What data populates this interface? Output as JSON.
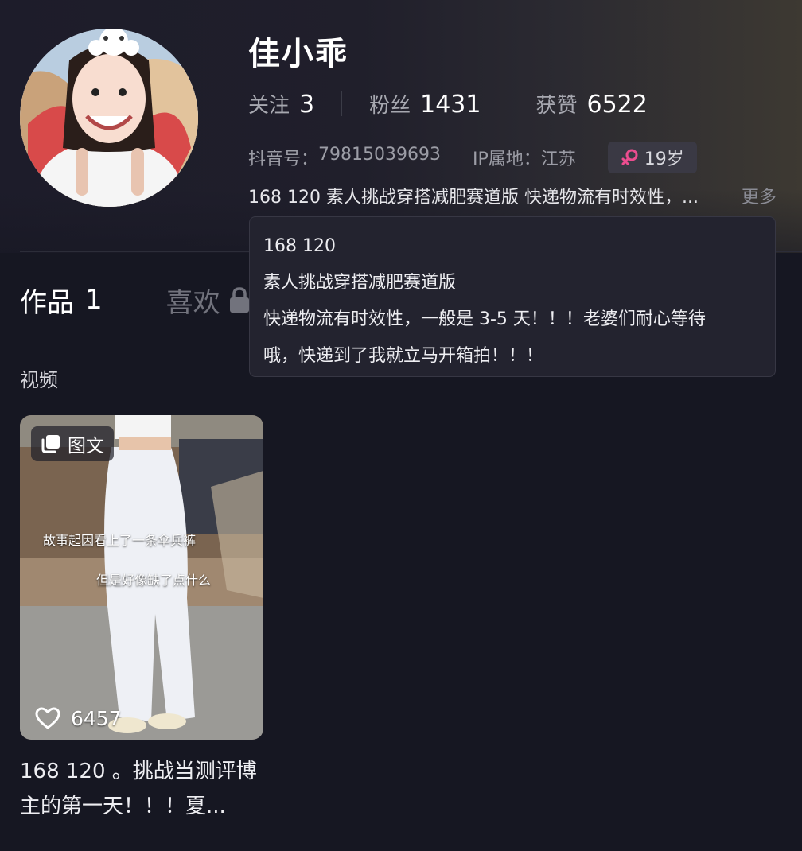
{
  "profile": {
    "nickname": "佳小乖",
    "stats": [
      {
        "label": "关注",
        "value": "3"
      },
      {
        "label": "粉丝",
        "value": "1431"
      },
      {
        "label": "获赞",
        "value": "6522"
      }
    ],
    "douyin_id_label": "抖音号：",
    "douyin_id": "79815039693",
    "ip_label": "IP属地：",
    "ip_location": "江苏",
    "age": "19岁",
    "gender_icon": "female-icon",
    "bio_summary": "168 120 素人挑战穿搭减肥赛道版 快递物流有时效性，...",
    "more_label": "更多"
  },
  "bio_tooltip": {
    "lines": [
      "168 120",
      "素人挑战穿搭减肥赛道版",
      "快递物流有时效性，一般是 3-5 天！！！老婆们耐心等待",
      "哦，快递到了我就立马开箱拍！！！"
    ]
  },
  "tabs": {
    "works_label": "作品",
    "works_count": "1",
    "likes_label": "喜欢",
    "likes_icon": "lock-icon"
  },
  "section": {
    "label": "视频"
  },
  "posts": [
    {
      "type_label": "图文",
      "overlay_lines": [
        "故事起因看上了一条伞兵裤",
        "但是好像缺了点什么"
      ],
      "likes": "6457",
      "title_line1": "168 120 。挑战当测评博",
      "title_line2": "主的第一天！！！夏..."
    }
  ],
  "colors": {
    "background": "#161722",
    "muted_text": "#a7a8b0",
    "badge_bg": "#3a3944",
    "female_pink": "#ec4d8f"
  }
}
